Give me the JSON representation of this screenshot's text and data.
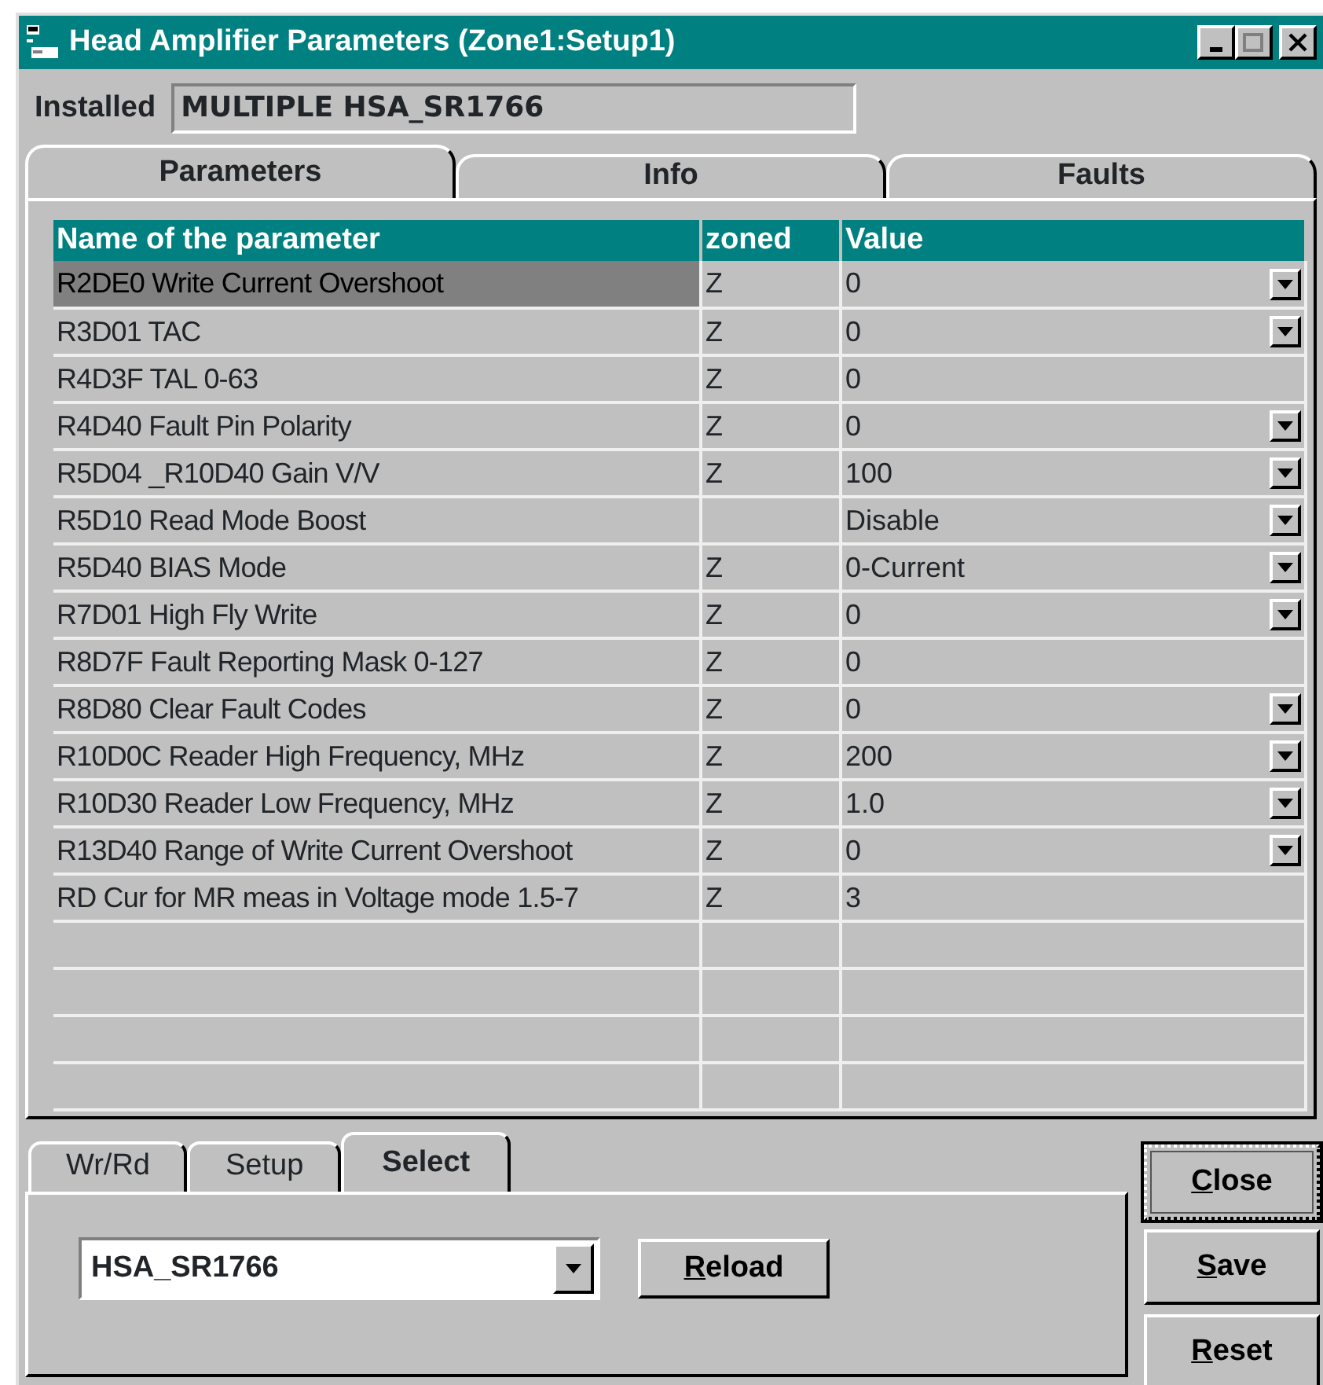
{
  "window": {
    "title": "Head Amplifier Parameters (Zone1:Setup1)"
  },
  "installed": {
    "label": "Installed",
    "value": "MULTIPLE HSA_SR1766"
  },
  "tabs": [
    {
      "label": "Parameters",
      "selected": true
    },
    {
      "label": "Info",
      "selected": false
    },
    {
      "label": "Faults",
      "selected": false
    }
  ],
  "table": {
    "columns": [
      "Name of the parameter",
      "zoned",
      "Value"
    ],
    "rows": [
      {
        "name": "R2DE0 Write Current Overshoot",
        "zoned": "Z",
        "value": "0",
        "dropdown": true,
        "selected": true
      },
      {
        "name": "R3D01 TAC",
        "zoned": "Z",
        "value": "0",
        "dropdown": true,
        "selected": false
      },
      {
        "name": "R4D3F TAL 0-63",
        "zoned": "Z",
        "value": "0",
        "dropdown": false,
        "selected": false
      },
      {
        "name": "R4D40 Fault Pin Polarity",
        "zoned": "Z",
        "value": "0",
        "dropdown": true,
        "selected": false
      },
      {
        "name": "R5D04 _R10D40 Gain V/V",
        "zoned": "Z",
        "value": "100",
        "dropdown": true,
        "selected": false
      },
      {
        "name": "R5D10 Read Mode Boost",
        "value": "Disable",
        "dropdown": true,
        "selected": false
      },
      {
        "name": "R5D40 BIAS Mode",
        "zoned": "Z",
        "value": "0-Current",
        "dropdown": true,
        "selected": false
      },
      {
        "name": "R7D01 High Fly Write",
        "zoned": "Z",
        "value": "0",
        "dropdown": true,
        "selected": false
      },
      {
        "name": "R8D7F Fault Reporting Mask 0-127",
        "zoned": "Z",
        "value": "0",
        "dropdown": false,
        "selected": false
      },
      {
        "name": "R8D80 Clear Fault Codes",
        "zoned": "Z",
        "value": "0",
        "dropdown": true,
        "selected": false
      },
      {
        "name": "R10D0C Reader High Frequency, MHz",
        "zoned": "Z",
        "value": "200",
        "dropdown": true,
        "selected": false
      },
      {
        "name": "R10D30 Reader Low Frequency, MHz",
        "zoned": "Z",
        "value": "1.0",
        "dropdown": true,
        "selected": false
      },
      {
        "name": "R13D40 Range of Write Current Overshoot",
        "zoned": "Z",
        "value": "0",
        "dropdown": true,
        "selected": false
      },
      {
        "name": "RD Cur for MR meas in Voltage mode 1.5-7",
        "zoned": "Z",
        "value": "3",
        "dropdown": false,
        "selected": false
      }
    ]
  },
  "bottom_tabs": [
    {
      "label": "Wr/Rd",
      "selected": false
    },
    {
      "label": "Setup",
      "selected": false
    },
    {
      "label": "Select",
      "selected": true
    }
  ],
  "select_panel": {
    "combo_value": "HSA_SR1766",
    "reload_button": "Reload"
  },
  "buttons": [
    {
      "label": "Close",
      "focused": true
    },
    {
      "label": "Save",
      "focused": false
    },
    {
      "label": "Reset",
      "focused": false
    }
  ]
}
